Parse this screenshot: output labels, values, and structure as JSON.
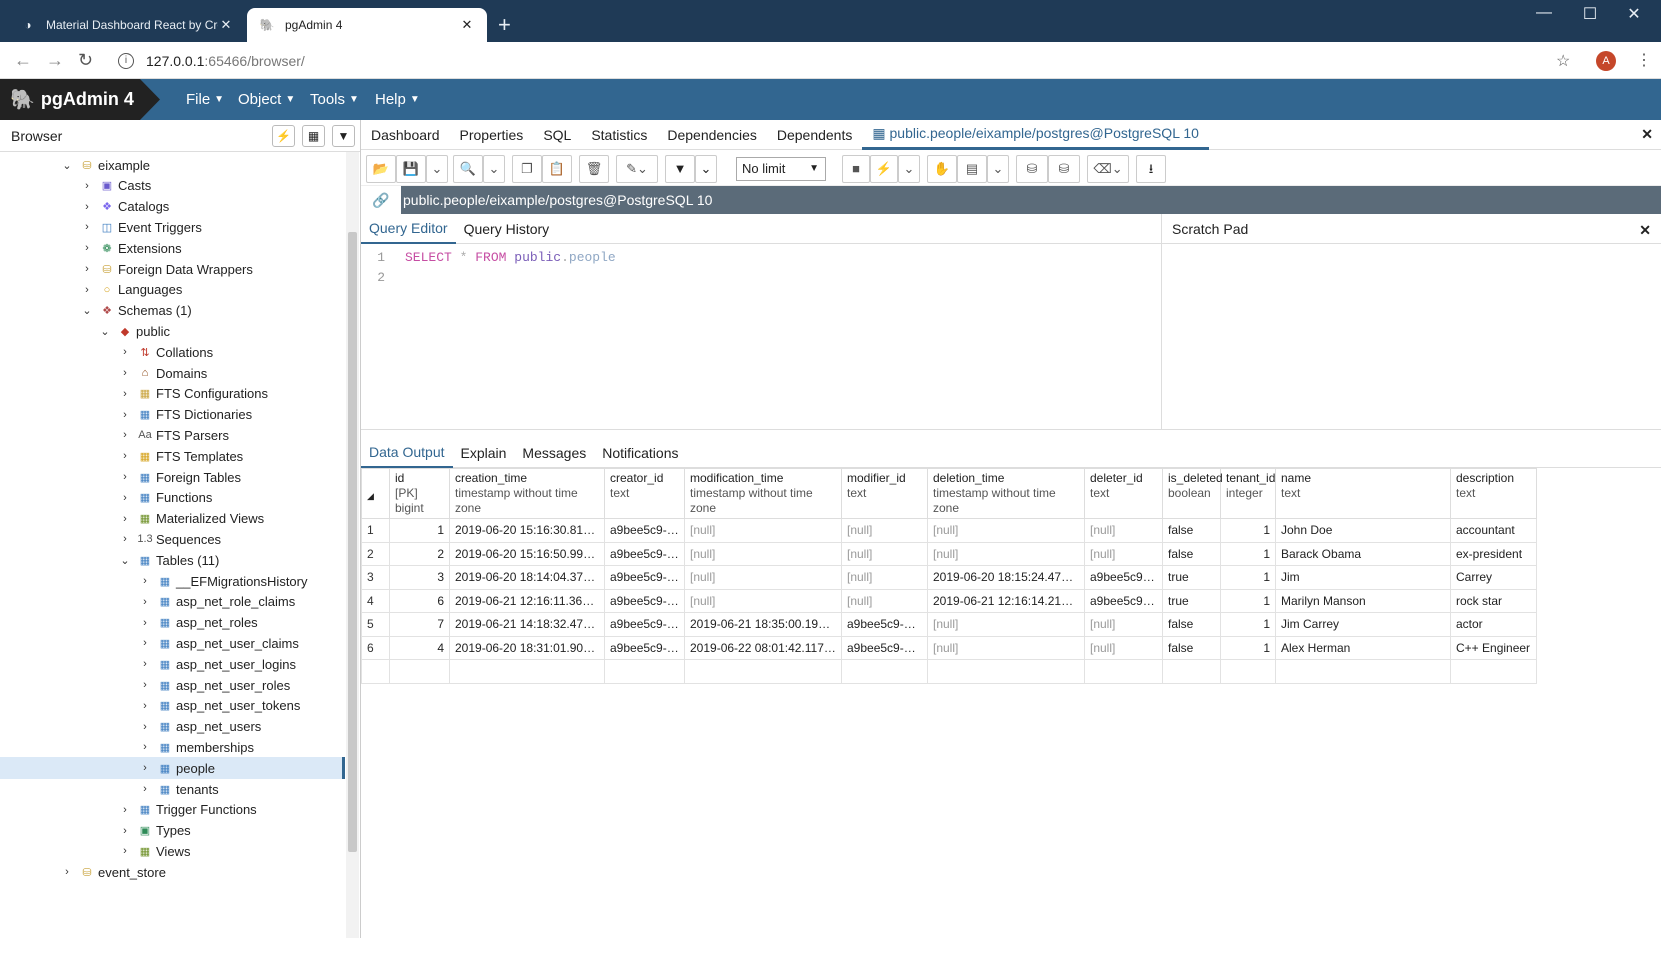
{
  "browser": {
    "tabs": [
      {
        "title": "Material Dashboard React by Cre",
        "icon": "mask-icon"
      },
      {
        "title": "pgAdmin 4",
        "icon": "elephant-icon"
      }
    ],
    "url_host": "127.0.0.1",
    "url_path": ":65466/browser/",
    "avatar_letter": "A"
  },
  "app": {
    "brand": "pgAdmin 4",
    "menus": [
      "File",
      "Object",
      "Tools",
      "Help"
    ]
  },
  "sidebar": {
    "title": "Browser",
    "tree": [
      {
        "label": "eixample",
        "level": 0,
        "expanded": true,
        "icon": "database-icon"
      },
      {
        "label": "Casts",
        "level": 1,
        "icon": "casts-icon"
      },
      {
        "label": "Catalogs",
        "level": 1,
        "icon": "catalogs-icon"
      },
      {
        "label": "Event Triggers",
        "level": 1,
        "icon": "event-triggers-icon"
      },
      {
        "label": "Extensions",
        "level": 1,
        "icon": "extensions-icon"
      },
      {
        "label": "Foreign Data Wrappers",
        "level": 1,
        "icon": "fdw-icon"
      },
      {
        "label": "Languages",
        "level": 1,
        "icon": "languages-icon"
      },
      {
        "label": "Schemas (1)",
        "level": 1,
        "expanded": true,
        "icon": "schemas-icon"
      },
      {
        "label": "public",
        "level": 2,
        "expanded": true,
        "icon": "schema-icon"
      },
      {
        "label": "Collations",
        "level": 3,
        "icon": "collations-icon"
      },
      {
        "label": "Domains",
        "level": 3,
        "icon": "domains-icon"
      },
      {
        "label": "FTS Configurations",
        "level": 3,
        "icon": "fts-config-icon"
      },
      {
        "label": "FTS Dictionaries",
        "level": 3,
        "icon": "fts-dict-icon"
      },
      {
        "label": "FTS Parsers",
        "level": 3,
        "icon": "fts-parser-icon"
      },
      {
        "label": "FTS Templates",
        "level": 3,
        "icon": "fts-template-icon"
      },
      {
        "label": "Foreign Tables",
        "level": 3,
        "icon": "foreign-table-icon"
      },
      {
        "label": "Functions",
        "level": 3,
        "icon": "functions-icon"
      },
      {
        "label": "Materialized Views",
        "level": 3,
        "icon": "matview-icon"
      },
      {
        "label": "Sequences",
        "level": 3,
        "icon": "sequences-icon"
      },
      {
        "label": "Tables (11)",
        "level": 3,
        "expanded": true,
        "icon": "tables-icon"
      },
      {
        "label": "__EFMigrationsHistory",
        "level": 4,
        "icon": "table-icon"
      },
      {
        "label": "asp_net_role_claims",
        "level": 4,
        "icon": "table-icon"
      },
      {
        "label": "asp_net_roles",
        "level": 4,
        "icon": "table-icon"
      },
      {
        "label": "asp_net_user_claims",
        "level": 4,
        "icon": "table-icon"
      },
      {
        "label": "asp_net_user_logins",
        "level": 4,
        "icon": "table-icon"
      },
      {
        "label": "asp_net_user_roles",
        "level": 4,
        "icon": "table-icon"
      },
      {
        "label": "asp_net_user_tokens",
        "level": 4,
        "icon": "table-icon"
      },
      {
        "label": "asp_net_users",
        "level": 4,
        "icon": "table-icon"
      },
      {
        "label": "memberships",
        "level": 4,
        "icon": "table-icon"
      },
      {
        "label": "people",
        "level": 4,
        "icon": "table-icon",
        "selected": true
      },
      {
        "label": "tenants",
        "level": 4,
        "icon": "table-icon"
      },
      {
        "label": "Trigger Functions",
        "level": 3,
        "icon": "trigger-functions-icon"
      },
      {
        "label": "Types",
        "level": 3,
        "icon": "types-icon"
      },
      {
        "label": "Views",
        "level": 3,
        "icon": "views-icon"
      },
      {
        "label": "event_store",
        "level": 0,
        "icon": "database-icon"
      }
    ]
  },
  "panel_tabs": [
    "Dashboard",
    "Properties",
    "SQL",
    "Statistics",
    "Dependencies",
    "Dependents",
    "public.people/eixample/postgres@PostgreSQL 10"
  ],
  "toolbar": {
    "limit": "No limit"
  },
  "connection": "public.people/eixample/postgres@PostgreSQL 10",
  "query_tabs": [
    "Query Editor",
    "Query History"
  ],
  "scratch_title": "Scratch Pad",
  "query": {
    "lines": [
      "1",
      "2"
    ],
    "kw1": "SELECT",
    "star": "*",
    "kw2": "FROM",
    "schema": "public",
    "dot": ".",
    "table": "people"
  },
  "output_tabs": [
    "Data Output",
    "Explain",
    "Messages",
    "Notifications"
  ],
  "grid": {
    "columns": [
      {
        "name": "id",
        "type": "[PK] bigint"
      },
      {
        "name": "creation_time",
        "type": "timestamp without time zone"
      },
      {
        "name": "creator_id",
        "type": "text"
      },
      {
        "name": "modification_time",
        "type": "timestamp without time zone"
      },
      {
        "name": "modifier_id",
        "type": "text"
      },
      {
        "name": "deletion_time",
        "type": "timestamp without time zone"
      },
      {
        "name": "deleter_id",
        "type": "text"
      },
      {
        "name": "is_deleted",
        "type": "boolean"
      },
      {
        "name": "tenant_id",
        "type": "integer"
      },
      {
        "name": "name",
        "type": "text"
      },
      {
        "name": "description",
        "type": "text"
      }
    ],
    "rows": [
      [
        "1",
        "1",
        "2019-06-20 15:16:30.813277",
        "a9bee5c9-6...",
        "[null]",
        "[null]",
        "[null]",
        "[null]",
        "false",
        "1",
        "John Doe",
        "accountant"
      ],
      [
        "2",
        "2",
        "2019-06-20 15:16:50.998228",
        "a9bee5c9-6...",
        "[null]",
        "[null]",
        "[null]",
        "[null]",
        "false",
        "1",
        "Barack Obama",
        "ex-president"
      ],
      [
        "3",
        "3",
        "2019-06-20 18:14:04.372703",
        "a9bee5c9-6...",
        "[null]",
        "[null]",
        "2019-06-20 18:15:24.474782",
        "a9bee5c9-6...",
        "true",
        "1",
        "Jim",
        "Carrey"
      ],
      [
        "4",
        "6",
        "2019-06-21 12:16:11.364628",
        "a9bee5c9-6...",
        "[null]",
        "[null]",
        "2019-06-21 12:16:14.219621",
        "a9bee5c9-6...",
        "true",
        "1",
        "Marilyn Manson",
        "rock star"
      ],
      [
        "5",
        "7",
        "2019-06-21 14:18:32.47467",
        "a9bee5c9-6...",
        "2019-06-21 18:35:00.193797",
        "a9bee5c9-60f...",
        "[null]",
        "[null]",
        "false",
        "1",
        "Jim Carrey",
        "actor"
      ],
      [
        "6",
        "4",
        "2019-06-20 18:31:01.903617",
        "a9bee5c9-6...",
        "2019-06-22 08:01:42.117132",
        "a9bee5c9-60f...",
        "[null]",
        "[null]",
        "false",
        "1",
        "Alex Herman",
        "C++ Engineer"
      ]
    ]
  },
  "colors": {
    "brand_blue": "#326690",
    "chrome_bar": "#1f3a56",
    "conn_bar": "#5b6b79"
  }
}
